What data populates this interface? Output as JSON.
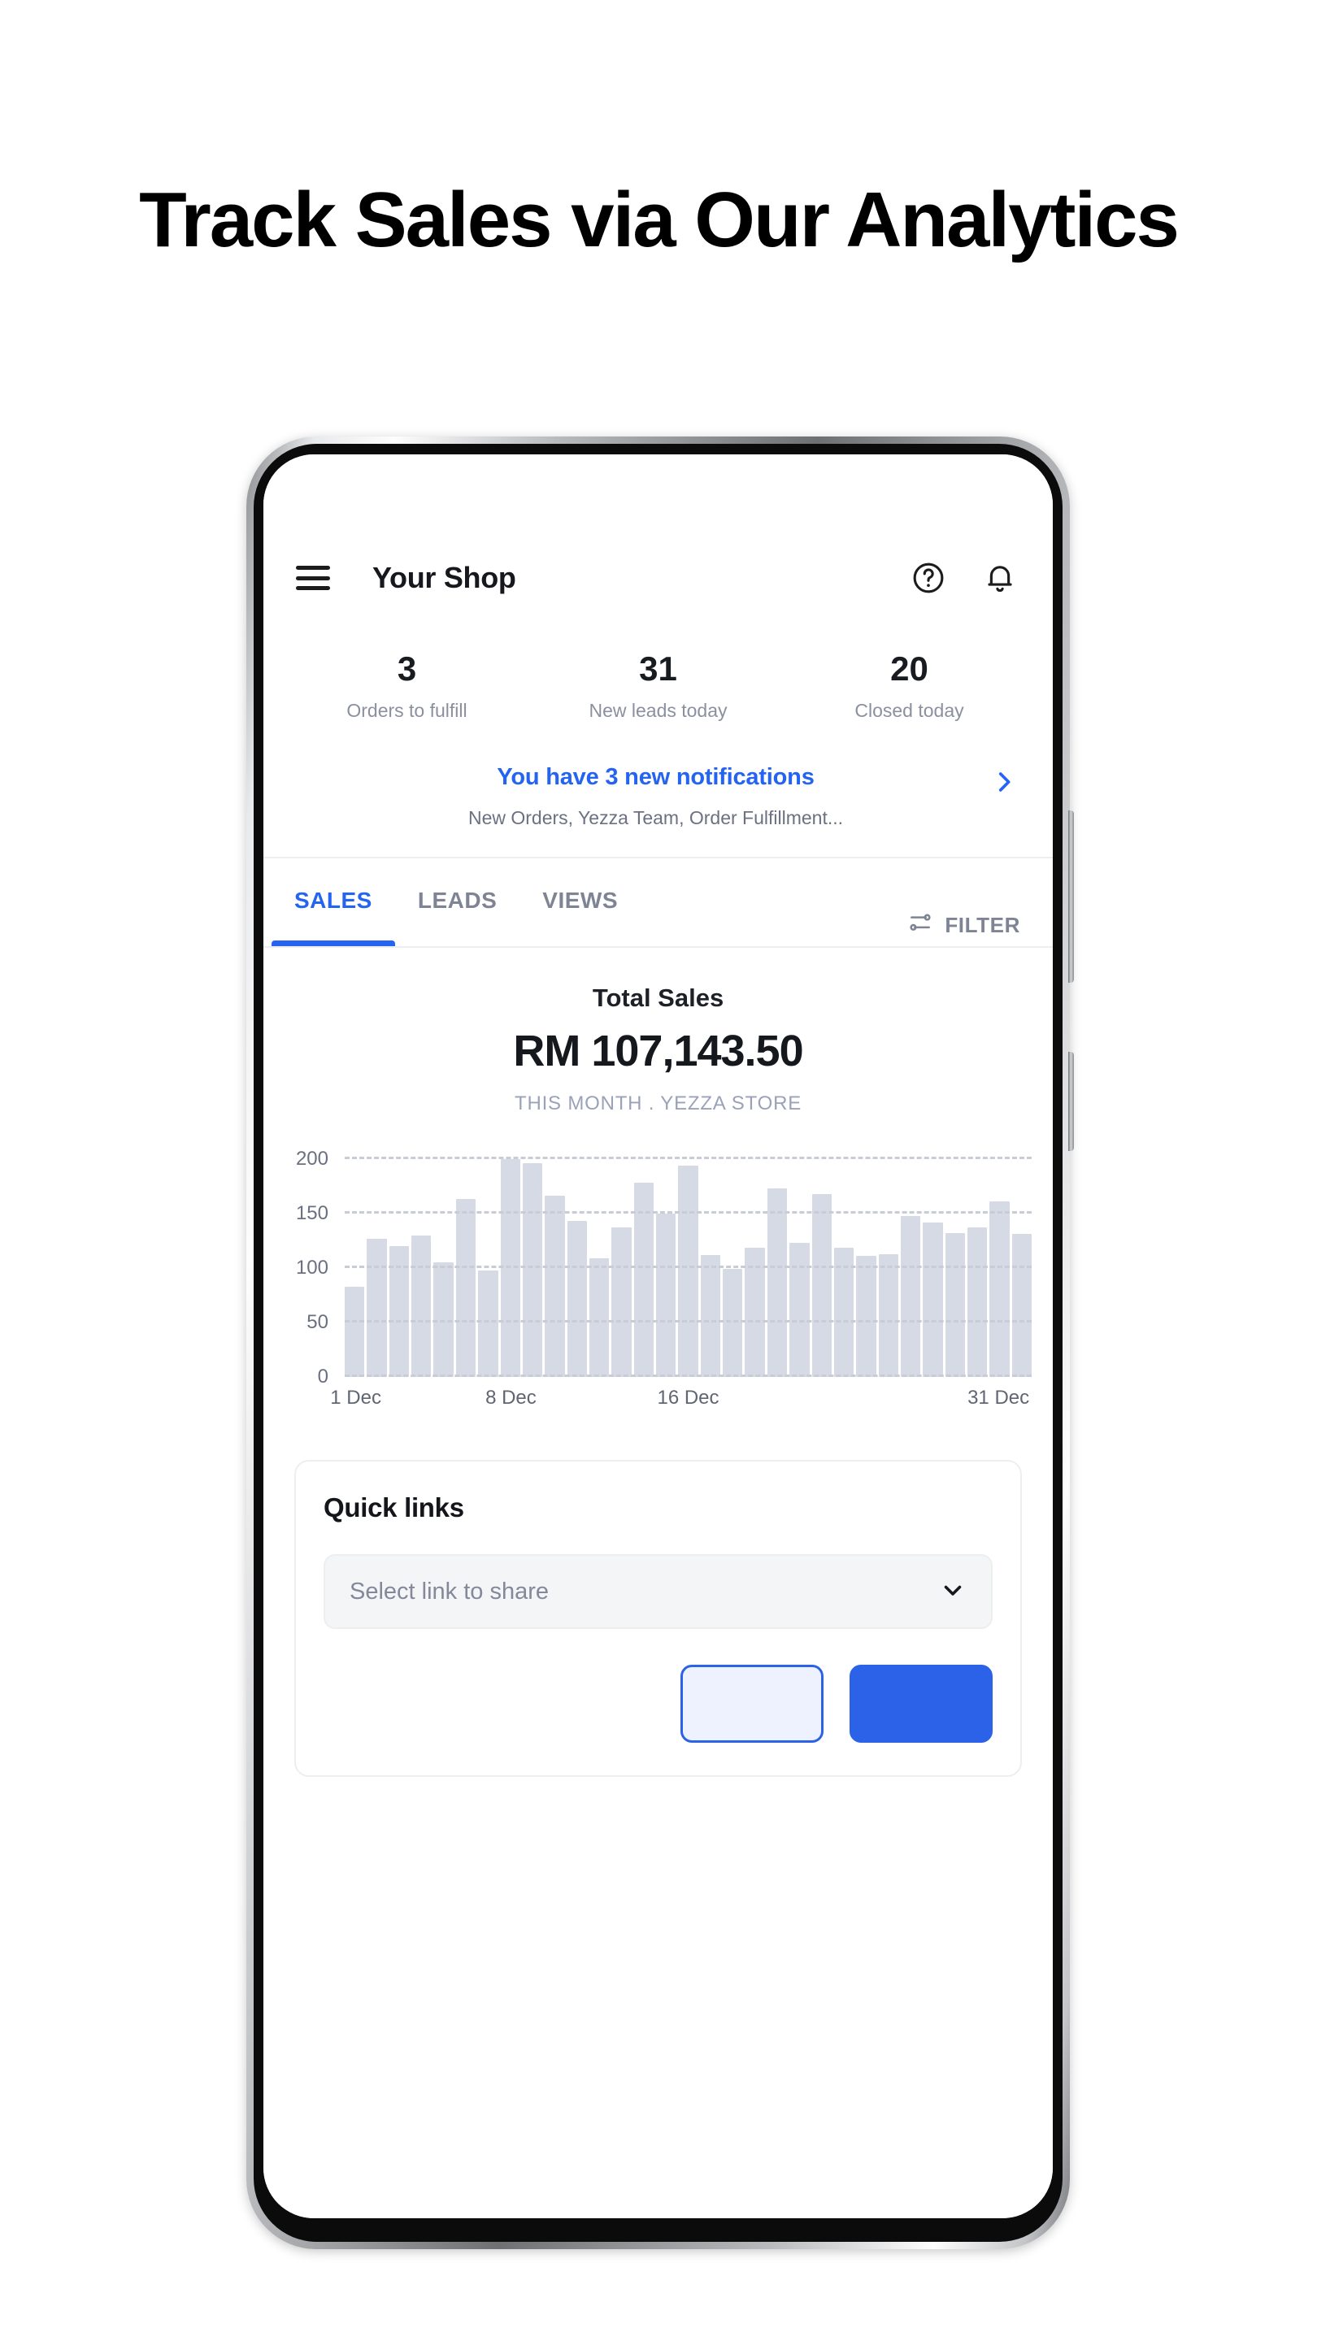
{
  "page": {
    "heading": "Track Sales via Our Analytics"
  },
  "app": {
    "appbar": {
      "menu_icon": "hamburger-menu-icon",
      "title": "Your Shop",
      "help_icon": "help-circle-icon",
      "bell_icon": "bell-icon"
    },
    "stats": [
      {
        "value": "3",
        "label": "Orders to fulfill"
      },
      {
        "value": "31",
        "label": "New leads today"
      },
      {
        "value": "20",
        "label": "Closed today"
      }
    ],
    "notification": {
      "title": "You have 3 new notifications",
      "subtitle": "New Orders, Yezza Team, Order Fulfillment...",
      "chevron_icon": "chevron-right-icon",
      "accent_color": "#2464f0"
    },
    "tabs": [
      {
        "label": "SALES",
        "active": true
      },
      {
        "label": "LEADS",
        "active": false
      },
      {
        "label": "VIEWS",
        "active": false
      }
    ],
    "filter": {
      "label": "FILTER",
      "icon": "sliders-icon"
    },
    "totals": {
      "label": "Total Sales",
      "amount": "RM 107,143.50",
      "meta": "THIS MONTH . YEZZA STORE"
    },
    "quick_links": {
      "title": "Quick links",
      "select_placeholder": "Select link to share",
      "select_chevron_icon": "chevron-down-icon",
      "secondary_button_label": "",
      "primary_button_label": ""
    },
    "device": {
      "camera": "punch-hole-camera",
      "side_buttons": [
        "volume-rocker",
        "power-button"
      ]
    }
  },
  "chart_data": {
    "type": "bar",
    "title": "Total Sales",
    "subtitle": "THIS MONTH . YEZZA STORE",
    "xlabel": "",
    "ylabel": "",
    "ylim": [
      0,
      210
    ],
    "yticks": [
      0,
      50,
      100,
      150,
      200
    ],
    "ytick_labels": [
      "0",
      "50",
      "100",
      "150",
      "200"
    ],
    "grid": true,
    "gridlines_dashed": true,
    "legend": "none",
    "bar_color": "#d6dae5",
    "categories": [
      "1 Dec",
      "2 Dec",
      "3 Dec",
      "4 Dec",
      "5 Dec",
      "6 Dec",
      "7 Dec",
      "8 Dec",
      "9 Dec",
      "10 Dec",
      "11 Dec",
      "12 Dec",
      "13 Dec",
      "14 Dec",
      "15 Dec",
      "16 Dec",
      "17 Dec",
      "18 Dec",
      "19 Dec",
      "20 Dec",
      "21 Dec",
      "22 Dec",
      "23 Dec",
      "24 Dec",
      "25 Dec",
      "26 Dec",
      "27 Dec",
      "28 Dec",
      "29 Dec",
      "30 Dec",
      "31 Dec"
    ],
    "xtick_labels": [
      {
        "label": "1 Dec",
        "index": 0
      },
      {
        "label": "8 Dec",
        "index": 7
      },
      {
        "label": "16 Dec",
        "index": 15
      },
      {
        "label": "31 Dec",
        "index": 29
      }
    ],
    "values": [
      83,
      127,
      120,
      130,
      105,
      163,
      98,
      200,
      196,
      166,
      143,
      109,
      137,
      178,
      150,
      194,
      112,
      99,
      119,
      173,
      123,
      168,
      119,
      111,
      113,
      148,
      142,
      132,
      137,
      161,
      131
    ]
  }
}
